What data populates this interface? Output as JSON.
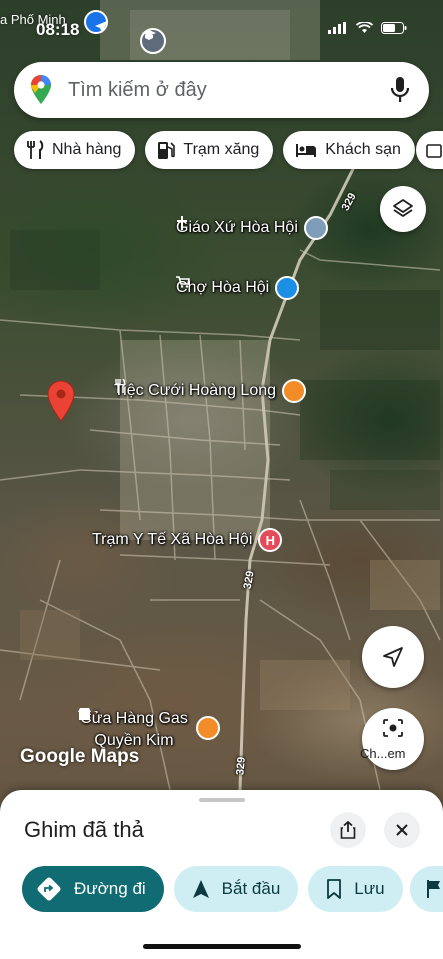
{
  "status_bar": {
    "time": "08:18",
    "place_hint": "a Phố Minh"
  },
  "search": {
    "placeholder": "Tìm kiếm ở đây"
  },
  "chips": [
    {
      "label": "Nhà hàng",
      "icon": "restaurant-icon"
    },
    {
      "label": "Trạm xăng",
      "icon": "gas-station-icon"
    },
    {
      "label": "Khách sạn",
      "icon": "hotel-icon"
    }
  ],
  "map": {
    "places": [
      {
        "name": "Giáo Xứ Hòa Hội",
        "icon": "church-icon",
        "color": "#7f9db8"
      },
      {
        "name": "Chợ Hòa Hội",
        "icon": "shopping-cart-icon",
        "color": "#1a8fe3"
      },
      {
        "name": "Tiệc Cưới Hoàng Long",
        "icon": "restaurant-icon",
        "color": "#f28c28"
      },
      {
        "name": "Trạm Y Tế Xã Hòa Hội",
        "icon": "hospital-icon",
        "badge_text": "H",
        "color": "#e34a5a"
      },
      {
        "name": "Cửa Hàng Gas Quyền Kim",
        "icon": "store-icon",
        "color": "#f28c28"
      }
    ],
    "road_numbers": [
      "329",
      "329",
      "329"
    ],
    "attribution": "Google Maps",
    "lens_label": "Ch...em",
    "dropped_pin_color": "#ea4335"
  },
  "sheet": {
    "title": "Ghim đã thả",
    "actions": [
      {
        "label": "Đường đi",
        "icon": "directions-icon"
      },
      {
        "label": "Bắt đầu",
        "icon": "navigation-arrow-icon"
      },
      {
        "label": "Lưu",
        "icon": "bookmark-icon"
      }
    ]
  },
  "colors": {
    "primary_action": "#116b72",
    "secondary_action": "#cfeef3"
  }
}
